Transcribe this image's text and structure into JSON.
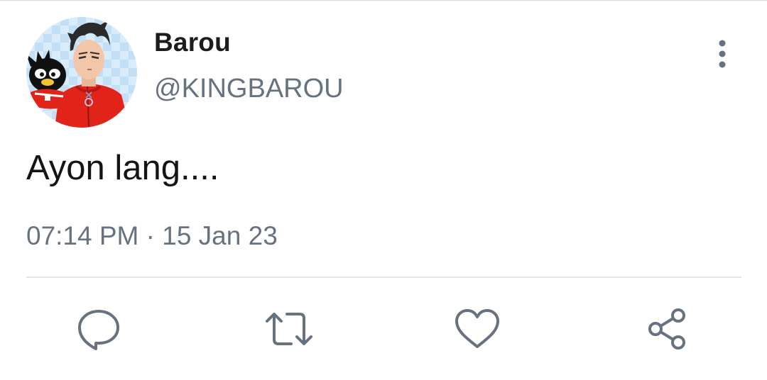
{
  "tweet": {
    "display_name": "Barou",
    "handle": "@KINGBAROU",
    "text": "Ayon lang....",
    "timestamp": "07:14 PM · 15 Jan 23"
  },
  "icons": {
    "more": "more-vertical-icon",
    "reply": "comment-bubble-icon",
    "retweet": "retweet-arrows-icon",
    "like": "heart-icon",
    "share": "share-nodes-icon"
  },
  "colors": {
    "name": "#1c1c1c",
    "secondary_text": "#66727f",
    "icon": "#66727f",
    "divider": "#e3e6e8"
  }
}
